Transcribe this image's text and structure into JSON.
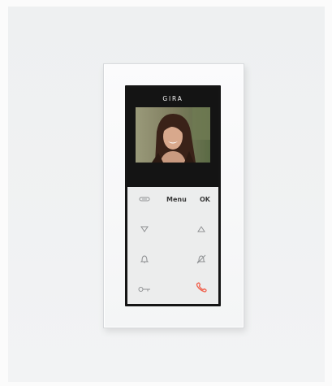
{
  "device": {
    "brand": "GIRA",
    "menu_label": "Menu",
    "ok_label": "OK"
  },
  "icons": {
    "intercom": "intercom-icon",
    "arrow_down": "triangle-down-icon",
    "arrow_up": "triangle-up-icon",
    "bell": "bell-icon",
    "bell_off": "bell-mute-icon",
    "door_key": "key-icon",
    "handset": "phone-handset-icon"
  },
  "colors": {
    "housing": "#141414",
    "keypad": "#eceded",
    "handset_accent": "#f0604c"
  }
}
